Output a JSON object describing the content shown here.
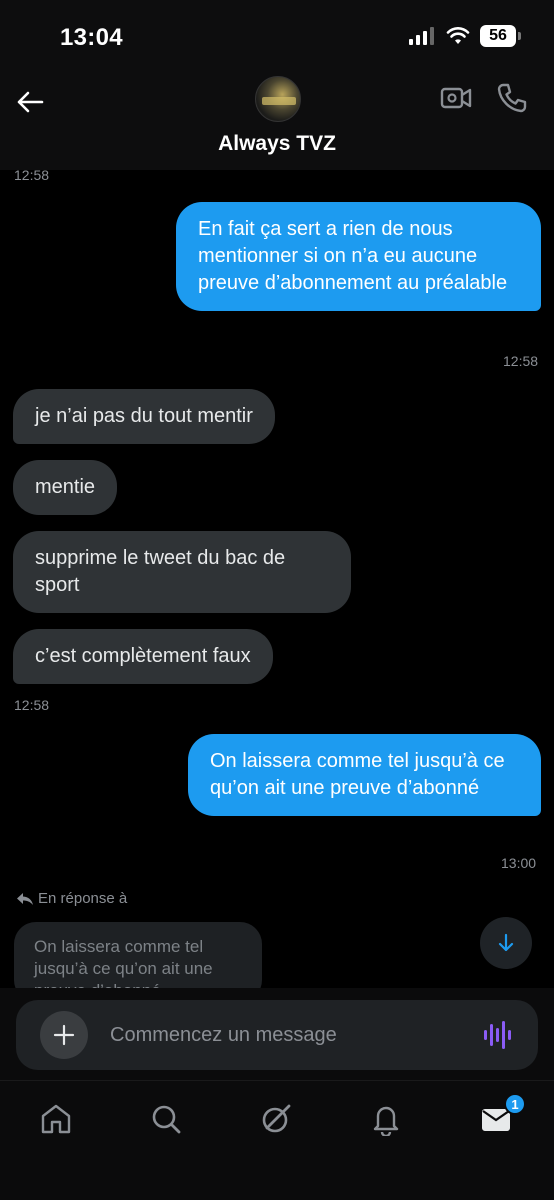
{
  "status_bar": {
    "time": "13:04",
    "battery": "56"
  },
  "header": {
    "title": "Always TVZ"
  },
  "messages": [
    {
      "kind": "timestamp",
      "text": "12:58"
    },
    {
      "kind": "outgoing",
      "text": "En fait ça sert a rien de nous mentionner si on n’a eu aucune preuve d’abonnement au préalable"
    },
    {
      "kind": "timestamp",
      "text": "12:58"
    },
    {
      "kind": "incoming",
      "text": "je n’ai pas du tout mentir"
    },
    {
      "kind": "incoming",
      "text": "mentie"
    },
    {
      "kind": "incoming",
      "text": "supprime le tweet du bac de sport"
    },
    {
      "kind": "incoming",
      "text": "c’est complètement faux"
    },
    {
      "kind": "timestamp",
      "text": "12:58"
    },
    {
      "kind": "outgoing",
      "text": "On laissera comme tel jusqu’à ce qu’on ait une preuve d’abonné"
    },
    {
      "kind": "timestamp",
      "text": "13:00"
    }
  ],
  "reply": {
    "label": "En réponse à",
    "preview": "On laissera comme tel jusqu’à ce qu’on ait une preuve d’abonné"
  },
  "composer": {
    "placeholder": "Commencez un message"
  },
  "tabs": [
    "home",
    "search",
    "grok",
    "notifications",
    "messages"
  ],
  "badge_count": "1",
  "colors": {
    "accent": "#1d9bf0",
    "voice": "#8b5cf6",
    "incoming_bubble": "#2f3336"
  }
}
